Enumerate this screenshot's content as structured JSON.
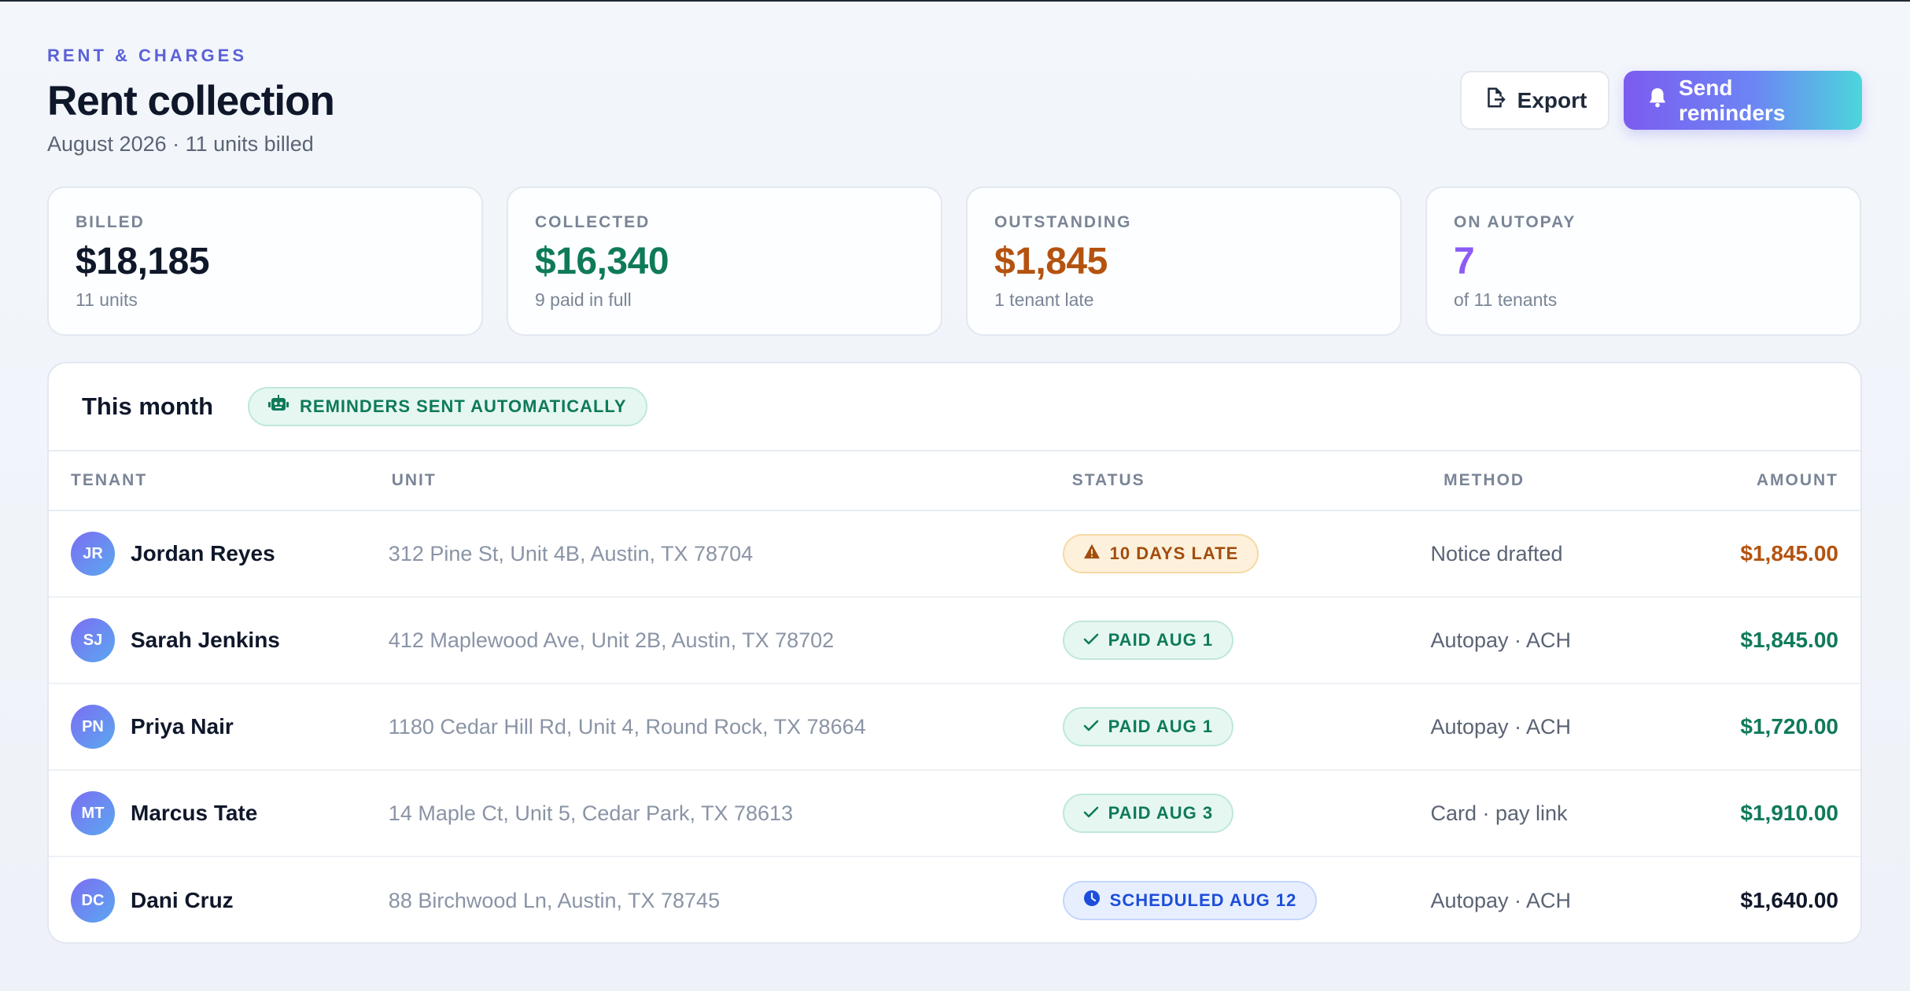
{
  "header": {
    "eyebrow": "RENT & CHARGES",
    "title": "Rent collection",
    "subtitle": "August 2026 · 11 units billed",
    "export_label": "Export",
    "send_label": "Send reminders"
  },
  "stats": [
    {
      "label": "BILLED",
      "value": "$18,185",
      "sub": "11 units",
      "color": "#0f172a"
    },
    {
      "label": "COLLECTED",
      "value": "$16,340",
      "sub": "9 paid in full",
      "color": "#0f7a5a"
    },
    {
      "label": "OUTSTANDING",
      "value": "$1,845",
      "sub": "1 tenant late",
      "color": "#b4530f"
    },
    {
      "label": "ON AUTOPAY",
      "value": "7",
      "sub": "of 11 tenants",
      "color": "#8b5cf6"
    }
  ],
  "table": {
    "title": "This month",
    "auto_badge": "REMINDERS SENT AUTOMATICALLY",
    "columns": {
      "tenant": "TENANT",
      "unit": "UNIT",
      "status": "STATUS",
      "method": "METHOD",
      "amount": "AMOUNT"
    },
    "rows": [
      {
        "initials": "JR",
        "name": "Jordan Reyes",
        "unit": "312 Pine St, Unit 4B, Austin, TX 78704",
        "status": "10 DAYS LATE",
        "status_type": "late",
        "method": "Notice drafted",
        "amount": "$1,845.00",
        "amount_color": "#b4530f"
      },
      {
        "initials": "SJ",
        "name": "Sarah Jenkins",
        "unit": "412 Maplewood Ave, Unit 2B, Austin, TX 78702",
        "status": "PAID AUG 1",
        "status_type": "paid",
        "method": "Autopay · ACH",
        "amount": "$1,845.00",
        "amount_color": "#0f7a5a"
      },
      {
        "initials": "PN",
        "name": "Priya Nair",
        "unit": "1180 Cedar Hill Rd, Unit 4, Round Rock, TX 78664",
        "status": "PAID AUG 1",
        "status_type": "paid",
        "method": "Autopay · ACH",
        "amount": "$1,720.00",
        "amount_color": "#0f7a5a"
      },
      {
        "initials": "MT",
        "name": "Marcus Tate",
        "unit": "14 Maple Ct, Unit 5, Cedar Park, TX 78613",
        "status": "PAID AUG 3",
        "status_type": "paid",
        "method": "Card · pay link",
        "amount": "$1,910.00",
        "amount_color": "#0f7a5a"
      },
      {
        "initials": "DC",
        "name": "Dani Cruz",
        "unit": "88 Birchwood Ln, Austin, TX 78745",
        "status": "SCHEDULED AUG 12",
        "status_type": "scheduled",
        "method": "Autopay · ACH",
        "amount": "$1,640.00",
        "amount_color": "#0f172a"
      }
    ]
  }
}
